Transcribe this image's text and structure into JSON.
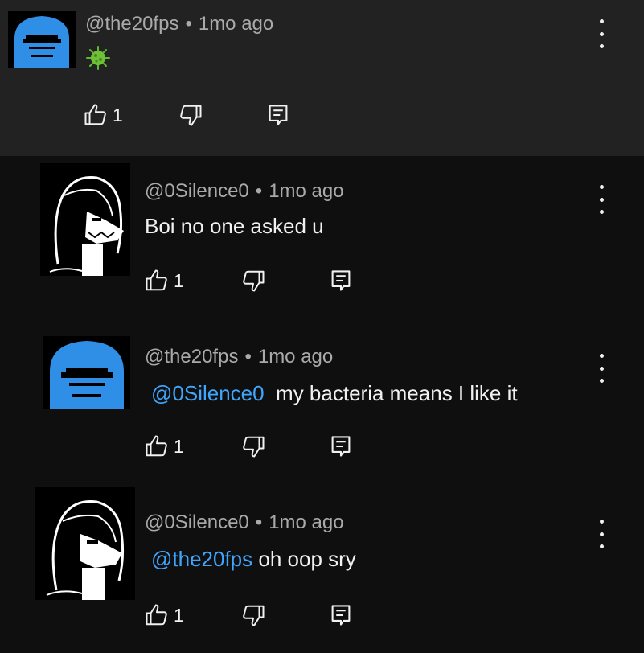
{
  "comments": [
    {
      "author": "@the20fps",
      "separator": "•",
      "time": "1mo ago",
      "body": "",
      "emoji": "microbe-emoji",
      "likes": "1",
      "avatar": "blue-haired-pixel-avatar"
    },
    {
      "author": "@0Silence0",
      "separator": "•",
      "time": "1mo ago",
      "body": "Boi no one asked u",
      "likes": "1",
      "avatar": "monochrome-pixel-avatar"
    },
    {
      "author": "@the20fps",
      "separator": "•",
      "time": "1mo ago",
      "mention": "@0Silence0",
      "body": "my bacteria means I like it",
      "likes": "1",
      "avatar": "blue-haired-pixel-avatar"
    },
    {
      "author": "@0Silence0",
      "separator": "•",
      "time": "1mo ago",
      "mention": "@the20fps",
      "body": "oh oop sry",
      "likes": "1",
      "avatar": "monochrome-pixel-avatar"
    }
  ],
  "colors": {
    "background": "#0f0f0f",
    "highlight_background": "#222222",
    "mention": "#3ea6ff",
    "meta_text": "#aaaaaa",
    "text": "#f1f1f1",
    "avatar_blue": "#2f8fe6"
  },
  "icons": [
    "like-icon",
    "dislike-icon",
    "reply-icon",
    "more-options-icon"
  ]
}
